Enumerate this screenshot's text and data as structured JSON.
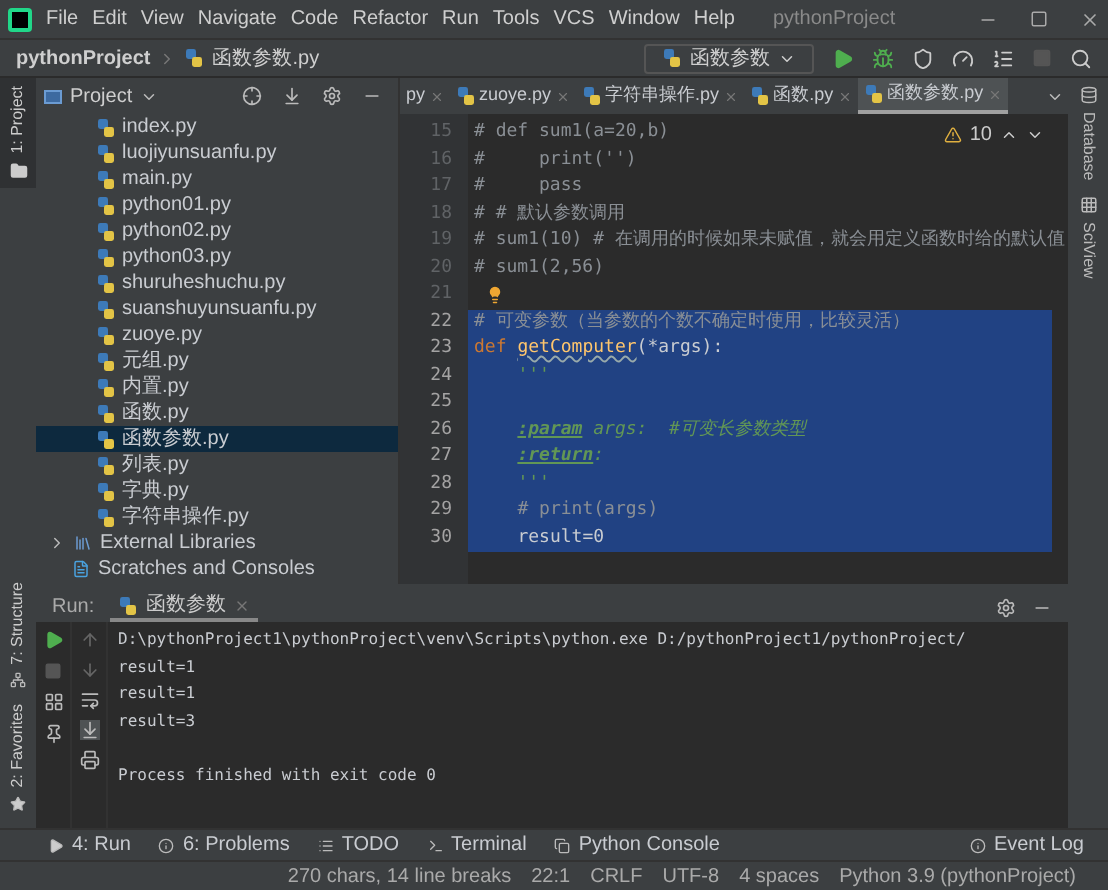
{
  "menu": [
    "File",
    "Edit",
    "View",
    "Navigate",
    "Code",
    "Refactor",
    "Run",
    "Tools",
    "VCS",
    "Window",
    "Help"
  ],
  "window": {
    "title": "pythonProject"
  },
  "breadcrumb": [
    "pythonProject",
    "函数参数.py"
  ],
  "run_config": "函数参数",
  "left_strip": [
    {
      "label": "1: Project",
      "selected": true
    }
  ],
  "project": {
    "title": "Project",
    "files": [
      {
        "name": "index.py",
        "selected": false
      },
      {
        "name": "luojiyunsuanfu.py",
        "selected": false
      },
      {
        "name": "main.py",
        "selected": false
      },
      {
        "name": "python01.py",
        "selected": false
      },
      {
        "name": "python02.py",
        "selected": false
      },
      {
        "name": "python03.py",
        "selected": false
      },
      {
        "name": "shuruheshuchu.py",
        "selected": false
      },
      {
        "name": "suanshuyunsuanfu.py",
        "selected": false
      },
      {
        "name": "zuoye.py",
        "selected": false
      },
      {
        "name": "元组.py",
        "selected": false
      },
      {
        "name": "内置.py",
        "selected": false
      },
      {
        "name": "函数.py",
        "selected": false
      },
      {
        "name": "函数参数.py",
        "selected": true
      },
      {
        "name": "列表.py",
        "selected": false
      },
      {
        "name": "字典.py",
        "selected": false
      },
      {
        "name": "字符串操作.py",
        "selected": false
      }
    ],
    "external": "External Libraries",
    "scratches": "Scratches and Consoles"
  },
  "tabs": [
    {
      "label": "py",
      "selected": false
    },
    {
      "label": "zuoye.py",
      "selected": false
    },
    {
      "label": "字符串操作.py",
      "selected": false
    },
    {
      "label": "函数.py",
      "selected": false
    },
    {
      "label": "函数参数.py",
      "selected": true
    }
  ],
  "warnings": "10",
  "editor_lines": [
    {
      "number": "15",
      "selected": false,
      "tokens": [
        {
          "kind": "comment",
          "text": "# def sum1(a=20,b)"
        }
      ]
    },
    {
      "number": "16",
      "selected": false,
      "tokens": [
        {
          "kind": "comment",
          "text": "#     print('')"
        }
      ]
    },
    {
      "number": "17",
      "selected": false,
      "tokens": [
        {
          "kind": "comment",
          "text": "#     pass"
        }
      ]
    },
    {
      "number": "18",
      "selected": false,
      "tokens": [
        {
          "kind": "comment",
          "text": "# # 默认参数调用"
        }
      ]
    },
    {
      "number": "19",
      "selected": false,
      "tokens": [
        {
          "kind": "comment",
          "text": "# sum1(10) # 在调用的时候如果未赋值，就会用定义函数时给的默认值"
        }
      ]
    },
    {
      "number": "20",
      "selected": false,
      "tokens": [
        {
          "kind": "comment",
          "text": "# sum1(2,56)"
        }
      ]
    },
    {
      "number": "21",
      "selected": false,
      "lightbulb": true
    },
    {
      "number": "22",
      "selected": true,
      "tokens": [
        {
          "kind": "comment",
          "text": "# 可变参数（当参数的个数不确定时使用，比较灵活）"
        }
      ]
    },
    {
      "number": "23",
      "selected": true,
      "tokens": [
        {
          "kind": "keyword",
          "text": "def "
        },
        {
          "kind": "function",
          "text": "getComputer"
        },
        {
          "kind": "plain",
          "text": "(*args):"
        }
      ]
    },
    {
      "number": "24",
      "selected": true,
      "tokens": [
        {
          "kind": "doc",
          "text": "    '''"
        }
      ]
    },
    {
      "number": "25",
      "selected": true
    },
    {
      "number": "26",
      "selected": true,
      "tokens": [
        {
          "kind": "doctag",
          "text": "    :param"
        },
        {
          "kind": "doc",
          "text": " args:  #可变长参数类型"
        }
      ]
    },
    {
      "number": "27",
      "selected": true,
      "tokens": [
        {
          "kind": "doctag",
          "text": "    :return"
        },
        {
          "kind": "doc",
          "text": ":"
        }
      ]
    },
    {
      "number": "28",
      "selected": true,
      "tokens": [
        {
          "kind": "doc",
          "text": "    '''"
        }
      ]
    },
    {
      "number": "29",
      "selected": true,
      "tokens": [
        {
          "kind": "comment",
          "text": "    # print(args)"
        }
      ]
    },
    {
      "number": "30",
      "selected": true,
      "tokens": [
        {
          "kind": "plain",
          "text": "    result=0"
        }
      ]
    }
  ],
  "right_strip": [
    "Database",
    "SciView"
  ],
  "run_panel": {
    "label": "Run:",
    "tab": "函数参数",
    "output": [
      [
        "D:\\pythonProject1\\pythonProject\\venv\\Scripts\\python.exe D:/pythonProject1/pythonProject/",
        "result=1",
        "result=1",
        "result=3"
      ],
      [
        "Process finished with exit code 0"
      ]
    ]
  },
  "side_bottom": [
    "7: Structure",
    "2: Favorites"
  ],
  "tool_tabs": [
    "4: Run",
    "6: Problems",
    "TODO",
    "Terminal",
    "Python Console",
    "Event Log"
  ],
  "status": [
    "270 chars, 14 line breaks",
    "22:1",
    "CRLF",
    "UTF-8",
    "4 spaces",
    "Python 3.9 (pythonProject)"
  ]
}
